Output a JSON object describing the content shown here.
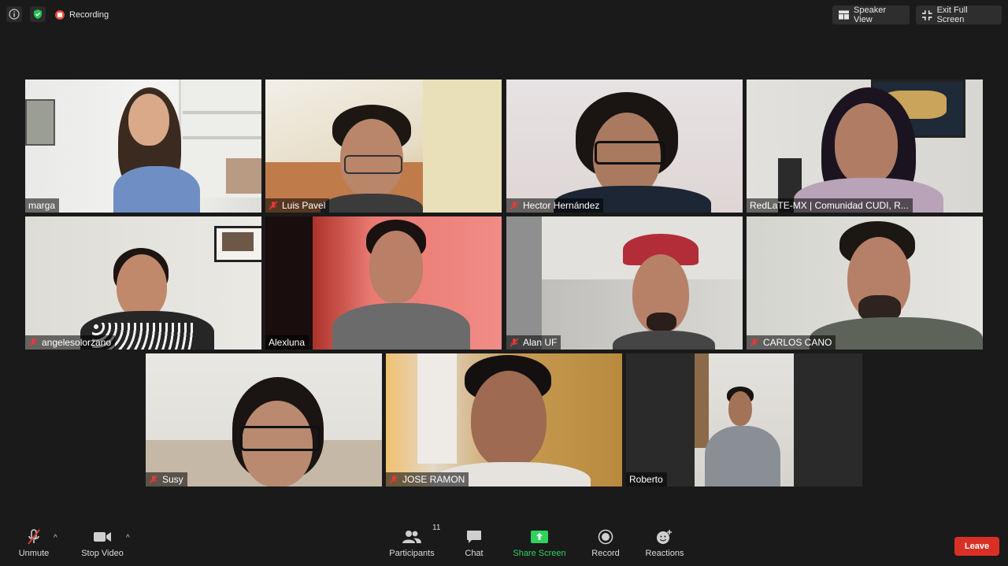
{
  "topbar": {
    "recording_label": "Recording",
    "speaker_view_label": "Speaker View",
    "exit_fullscreen_label": "Exit Full Screen"
  },
  "participants": [
    {
      "name": "marga",
      "muted": false
    },
    {
      "name": "Luis Pavel",
      "muted": true
    },
    {
      "name": "Hector Hernández",
      "muted": true
    },
    {
      "name": "RedLaTE-MX | Comunidad CUDI, R...",
      "muted": false
    },
    {
      "name": "angelesolorzano",
      "muted": true
    },
    {
      "name": "Alexluna",
      "muted": false,
      "active_speaker": true
    },
    {
      "name": "Alan UF",
      "muted": true
    },
    {
      "name": "CARLOS CANO",
      "muted": true
    },
    {
      "name": "Susy",
      "muted": true
    },
    {
      "name": "JOSE RAMON",
      "muted": true
    },
    {
      "name": "Roberto",
      "muted": false
    }
  ],
  "toolbar": {
    "unmute_label": "Unmute",
    "stop_video_label": "Stop Video",
    "participants_label": "Participants",
    "participants_count": "11",
    "chat_label": "Chat",
    "share_screen_label": "Share Screen",
    "record_label": "Record",
    "reactions_label": "Reactions",
    "leave_label": "Leave"
  },
  "colors": {
    "background": "#1a1a1a",
    "active_speaker_border": "#d9e26a",
    "share_green": "#2fd25a",
    "leave_red": "#d93025",
    "recording_red": "#e84e3c"
  }
}
